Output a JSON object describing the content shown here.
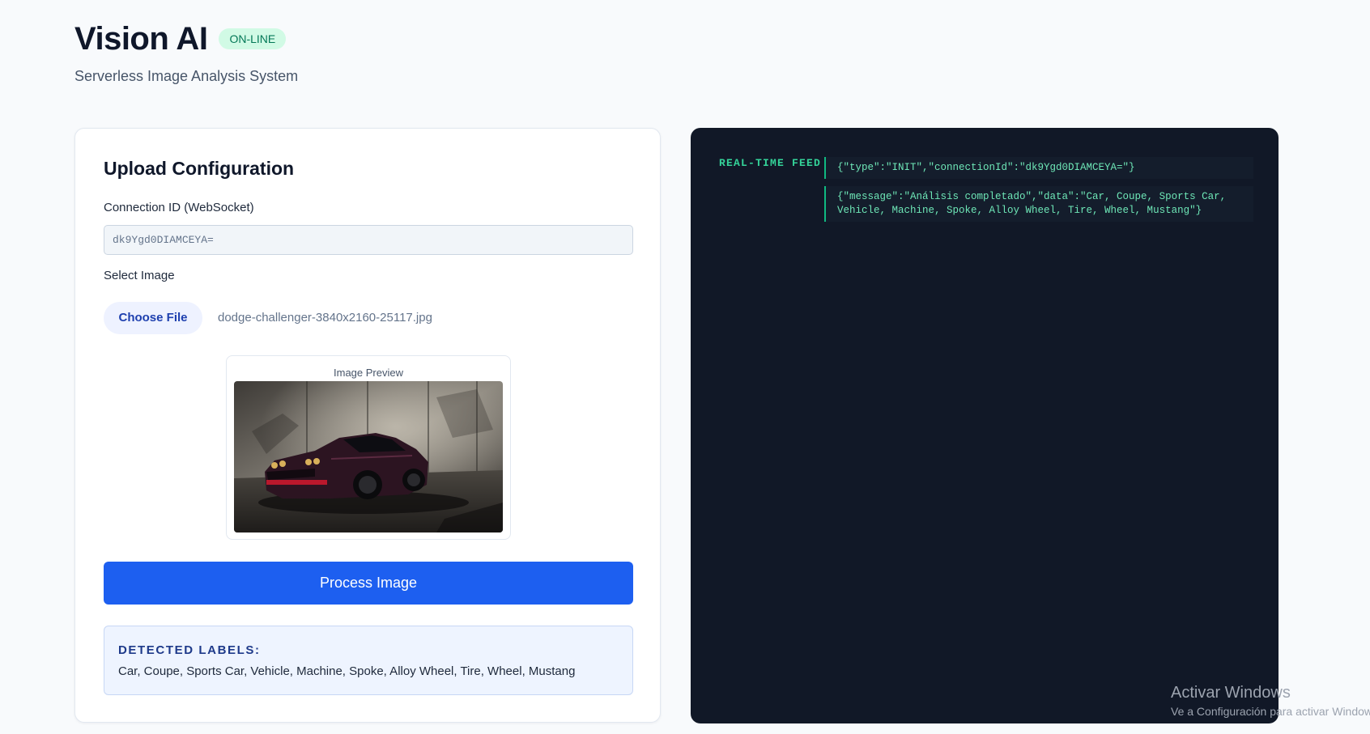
{
  "header": {
    "title": "Vision AI",
    "status": "ON-LINE",
    "subtitle": "Serverless Image Analysis System"
  },
  "upload": {
    "title": "Upload Configuration",
    "connection_label": "Connection ID (WebSocket)",
    "connection_value": "dk9Ygd0DIAMCEYA=",
    "select_label": "Select Image",
    "choose_file_label": "Choose File",
    "file_name": "dodge-challenger-3840x2160-25117.jpg",
    "preview_label": "Image Preview",
    "process_button": "Process Image",
    "detected_heading": "DETECTED LABELS:",
    "detected_labels": "Car, Coupe, Sports Car, Vehicle, Machine, Spoke, Alloy Wheel, Tire, Wheel, Mustang"
  },
  "feed": {
    "title": "REAL-TIME FEED",
    "entries": [
      "{\"type\":\"INIT\",\"connectionId\":\"dk9Ygd0DIAMCEYA=\"}",
      "{\"message\":\"Análisis completado\",\"data\":\"Car, Coupe, Sports Car, Vehicle, Machine, Spoke, Alloy Wheel, Tire, Wheel, Mustang\"}"
    ]
  },
  "watermark": {
    "title": "Activar Windows",
    "subtitle": "Ve a Configuración para activar Windows."
  },
  "colors": {
    "accent": "#1d5ff0",
    "feed_background": "#111827",
    "feed_text": "#6ee7b7",
    "status_badge": "#d1fae5"
  }
}
